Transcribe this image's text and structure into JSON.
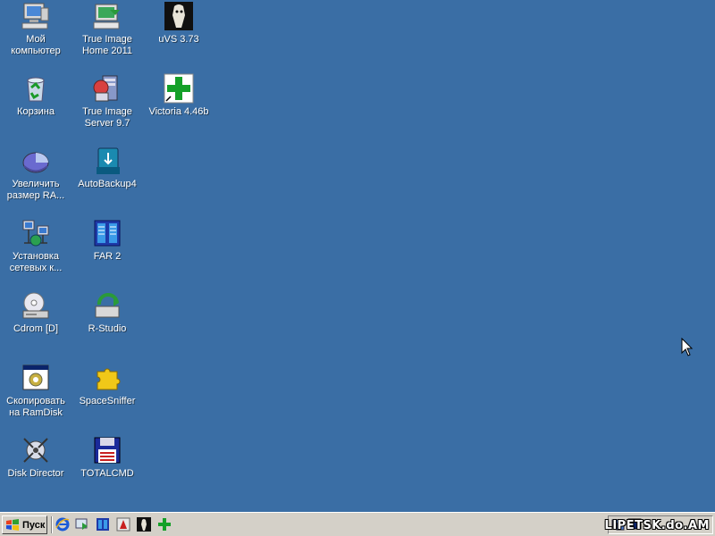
{
  "desktop": {
    "background_color": "#3a6ea5",
    "icons": [
      {
        "label": "Мой компьютер",
        "icon": "my-computer-icon"
      },
      {
        "label": "Корзина",
        "icon": "recycle-bin-icon"
      },
      {
        "label": "Увеличить размер RA...",
        "icon": "ramdisk-resize-icon"
      },
      {
        "label": "Установка сетевых к...",
        "icon": "network-install-icon"
      },
      {
        "label": "Cdrom [D]",
        "icon": "cdrom-drive-icon"
      },
      {
        "label": "Скопировать на RamDisk",
        "icon": "copy-to-ramdisk-icon"
      },
      {
        "label": "Disk Director",
        "icon": "disk-director-icon"
      },
      {
        "label": "True Image Home 2011",
        "icon": "true-image-home-icon"
      },
      {
        "label": "True Image Server 9.7",
        "icon": "true-image-server-icon"
      },
      {
        "label": "AutoBackup4",
        "icon": "autobackup-icon"
      },
      {
        "label": "FAR 2",
        "icon": "far-manager-icon"
      },
      {
        "label": "R-Studio",
        "icon": "r-studio-icon"
      },
      {
        "label": "SpaceSniffer",
        "icon": "spacesniffer-icon"
      },
      {
        "label": "TOTALCMD",
        "icon": "total-commander-icon"
      },
      {
        "label": "uVS 3.73",
        "icon": "uvs-icon"
      },
      {
        "label": "Victoria 4.46b",
        "icon": "victoria-icon"
      }
    ]
  },
  "taskbar": {
    "start_label": "Пуск",
    "quick_launch": [
      "ie-icon",
      "autobackup-icon",
      "far-manager-icon",
      "disk-director-icon",
      "uvs-icon",
      "victoria-icon"
    ],
    "tray_text": "LIPETSK.do.AM"
  }
}
